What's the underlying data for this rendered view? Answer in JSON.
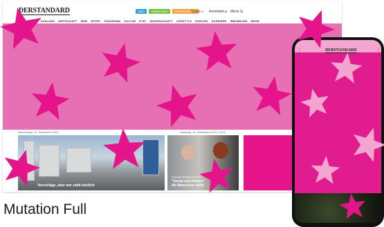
{
  "desktop": {
    "logo": "DERSTANDARD",
    "pills": [
      {
        "label": "ABO",
        "color": "#37a6d6"
      },
      {
        "label": "ANMELDEN",
        "color": "#7cbf4a"
      },
      {
        "label": "DERSTANDARD",
        "color": "#f2a33a"
      }
    ],
    "search_label": "Suche",
    "account_label": "Anmelden",
    "menu_label": "Menü",
    "nav": [
      "INLAND",
      "AUSLAND",
      "WIRTSCHAFT",
      "WEB",
      "SPORT",
      "PANORAMA",
      "KULTUR",
      "ETAT",
      "WISSENSCHAFT",
      "LIFESTYLE",
      "DISKURS",
      "KARRIERE",
      "IMMOBILIEN",
      "MEHR"
    ],
    "date_left": "Donnerstag, 19. Dezember 2019",
    "date_right": "Samstag, 14. Dezember 2019 | 14:11",
    "article1_caption": "Vorschläge, aber wer zahlt letztlich",
    "article2_kicker": "FRAUEN SOZIALPOLITIK",
    "article2_caption": "\"Sozial und Frauen\"\ndie Menschen nicht"
  },
  "phone": {
    "logo": "DERSTANDARD"
  },
  "caption": "Mutation Full",
  "colors": {
    "pink_bg": "#e76fb4",
    "star_pink": "#e4158a",
    "star_light": "#f2a6cf"
  }
}
